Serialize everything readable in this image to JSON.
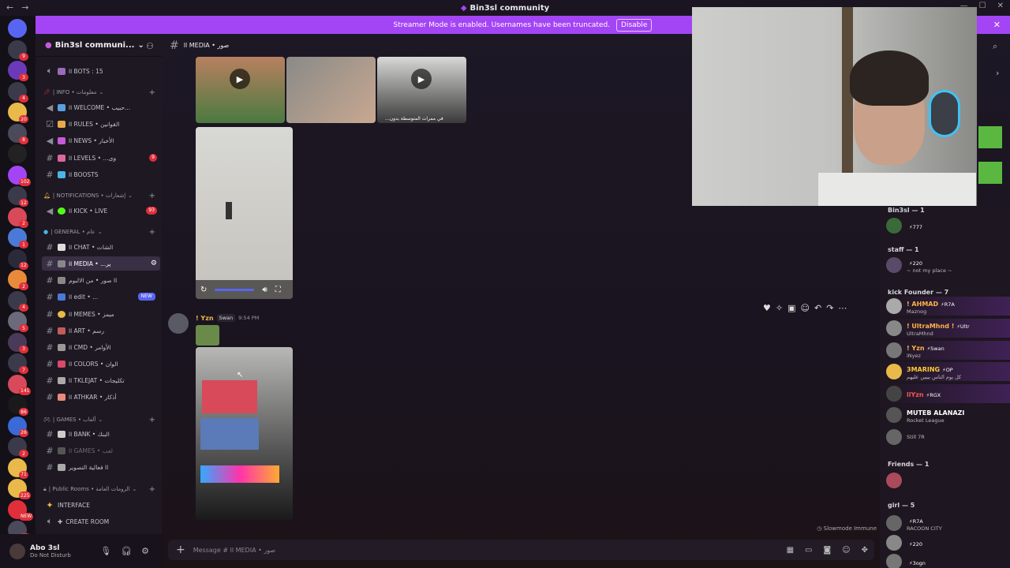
{
  "titlebar": {
    "title": "Bin3sl community"
  },
  "banner": {
    "text": "Streamer Mode is enabled. Usernames have been truncated.",
    "disable_label": "Disable"
  },
  "servers": [
    {
      "badge": ""
    },
    {
      "badge": "9"
    },
    {
      "badge": "3"
    },
    {
      "badge": "4"
    },
    {
      "badge": "20"
    },
    {
      "badge": "8"
    },
    {
      "badge": ""
    },
    {
      "badge": "102"
    },
    {
      "badge": "12"
    },
    {
      "badge": "2"
    },
    {
      "badge": "1"
    },
    {
      "badge": "12"
    },
    {
      "badge": "2"
    },
    {
      "badge": "4"
    },
    {
      "badge": "5"
    },
    {
      "badge": "3"
    },
    {
      "badge": "7"
    },
    {
      "badge": "141"
    },
    {
      "badge": "86"
    },
    {
      "badge": "26"
    },
    {
      "badge": "2"
    },
    {
      "badge": "71"
    },
    {
      "badge": "225"
    },
    {
      "badge": "NEW"
    },
    {
      "badge": "247"
    }
  ],
  "guild": {
    "name": "Bin3sl communi..."
  },
  "channels": {
    "bots": "اا BOTS : 15",
    "cat_info": "| INFO • معلومات",
    "welcome": "اا WELCOME • حبيب...",
    "rules": "اا RULES • القوانين",
    "news": "اا NEWS • الأخبار",
    "levels": "اا LEVELS • ...وى",
    "levels_badge": "9",
    "boosts": "اا BOOSTS",
    "cat_notif": "| NOTIFICATIONS • إشعارات",
    "kick": "اا KICK • LIVE",
    "kick_badge": "93",
    "cat_general": "| GENERAL • عام",
    "chat": "اا CHAT • الشات",
    "media": "اا MEDIA • ...ير",
    "album": "اا صور • من الالبوم",
    "edit": "اا edit • ...",
    "edit_new": "NEW",
    "memes": "اا MEMES • ميمز",
    "art": "اا ART • رسم",
    "cmd": "اا CMD • الأوامر",
    "colors": "اا COLORS • الوان",
    "tklejat": "اا TKLEJAT • تكليجات",
    "athkar": "اا ATHKAR • أذكار",
    "cat_games": "| GAMES • ألعاب",
    "bank": "اا BANK • البنك",
    "games": "اا GAMES • لعب",
    "photo_event": "اا فعالية التصوير",
    "cat_public": "| Public Rooms • الرومات العامة",
    "interface": "INTERFACE",
    "create_room": "CREATE ROOM"
  },
  "user": {
    "name": "Abo 3sl",
    "status": "Do Not Disturb"
  },
  "chat": {
    "header": "اا MEDIA • صور",
    "video_caption": "...في ممرات المتوسطة بدون",
    "msg_user": "! Yzn",
    "msg_tag": "Swan",
    "msg_time": "9:54 PM",
    "slowmode": "Slowmode Immune",
    "composer_placeholder": "Message # اا MEDIA • صور"
  },
  "members": {
    "groups": [
      {
        "label": "Bin3sl — 1"
      },
      {
        "label": "staff — 1"
      },
      {
        "label": "kick Founder — 7"
      },
      {
        "label": "Friends — 1"
      },
      {
        "label": "girl — 5"
      }
    ],
    "items": [
      {
        "name": "",
        "tag": "777",
        "sub": "",
        "color": "#e9b949"
      },
      {
        "name": "",
        "tag": "220",
        "sub": "~ not my place ~",
        "color": "#ff5555"
      },
      {
        "name": "! AHMAD",
        "tag": "R7A",
        "sub": "Maznog",
        "color": "#ffb347"
      },
      {
        "name": "! UltraMhnd !",
        "tag": "Ultr",
        "sub": "UltraMhnd",
        "color": "#ffb347"
      },
      {
        "name": "! Yzn",
        "tag": "Swan",
        "sub": "iNyez",
        "color": "#ffb347"
      },
      {
        "name": "3MARING",
        "tag": "OP",
        "sub": "كل يوم الناس بيبين عليهم",
        "color": "#ffcc33"
      },
      {
        "name": "llYzn",
        "tag": "RGX",
        "sub": "",
        "color": "#ff5555"
      },
      {
        "name": "MUTEB ALANAZI",
        "tag": "",
        "sub": "Rocket League",
        "color": "#ffffff"
      },
      {
        "name": "",
        "tag": "",
        "sub": "Still 7R",
        "color": "#bbbbbb"
      },
      {
        "name": "",
        "tag": "",
        "sub": "",
        "color": "#c45bd8"
      },
      {
        "name": "",
        "tag": "R7A",
        "sub": "RACOON CITY",
        "color": "#ff5555"
      },
      {
        "name": "",
        "tag": "220",
        "sub": "",
        "color": "#ff5555"
      },
      {
        "name": "",
        "tag": "3ogn",
        "sub": "",
        "color": "#ff5555"
      }
    ]
  },
  "colors": {
    "accent": "#a445f5",
    "blurple": "#5865f2",
    "red": "#e02f3a"
  }
}
